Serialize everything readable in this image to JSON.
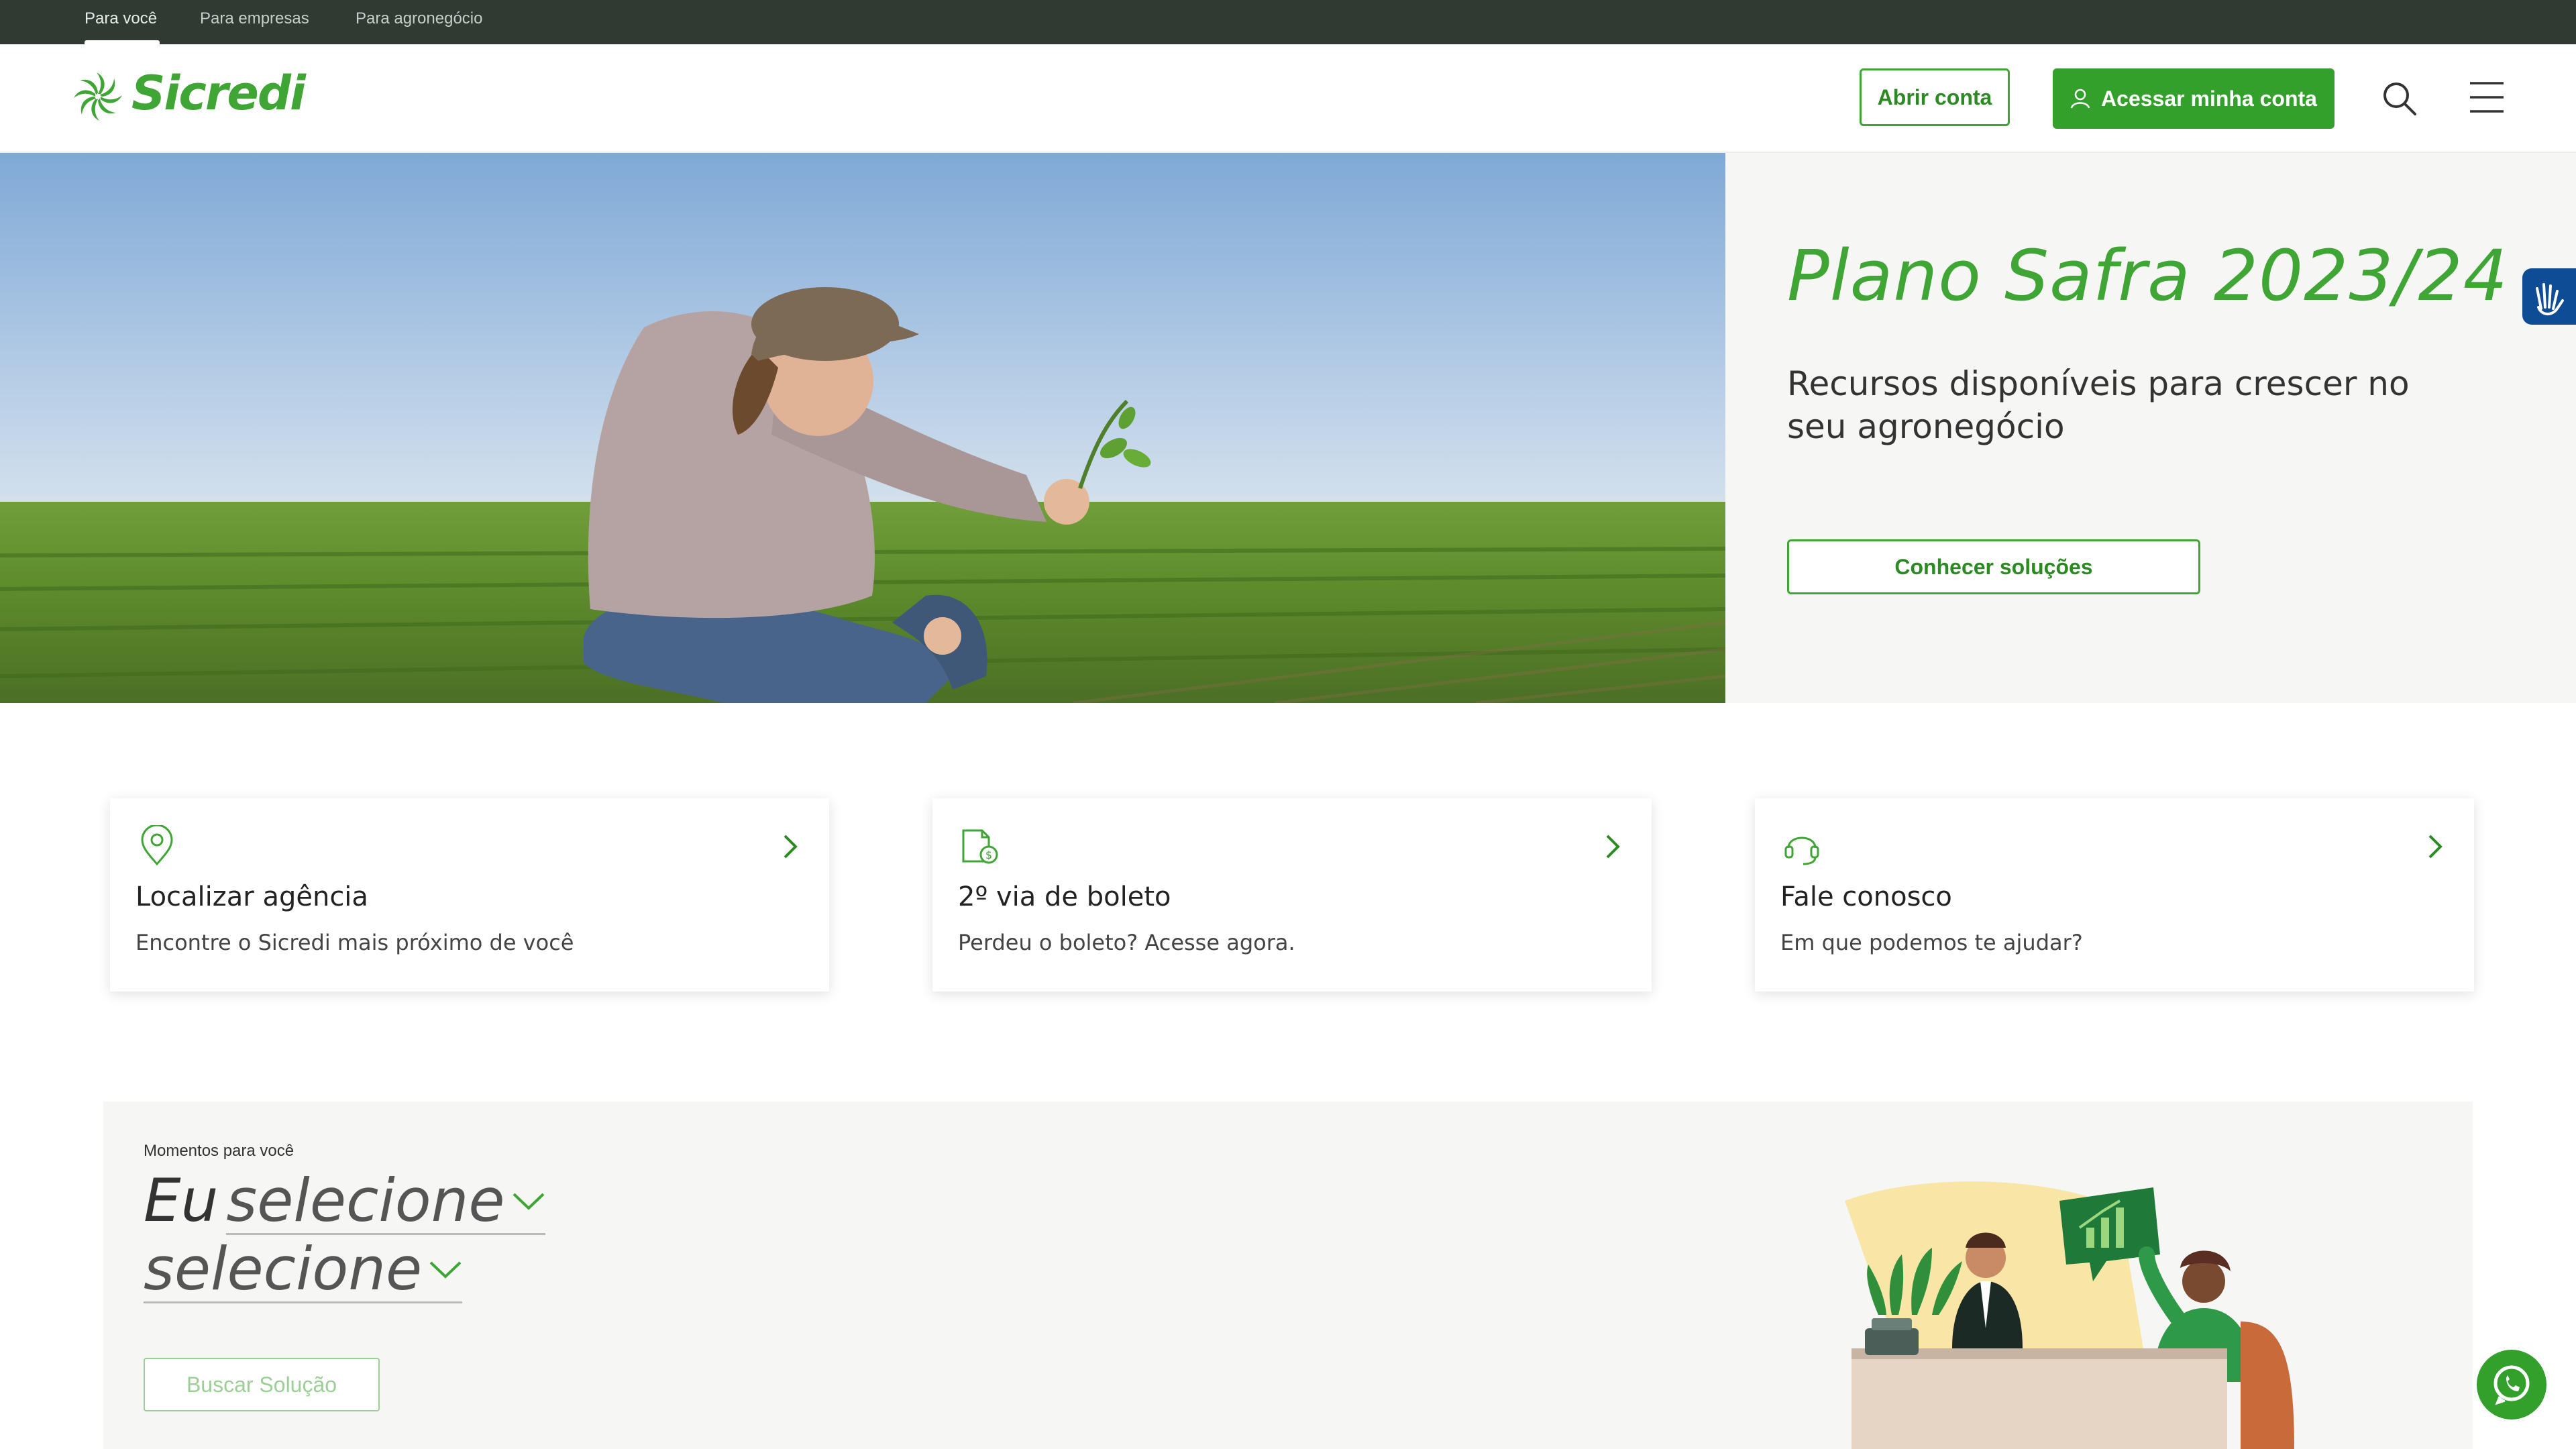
{
  "topbar": {
    "links": [
      "Para você",
      "Para empresas",
      "Para agronegócio"
    ]
  },
  "header": {
    "logo_text": "Sicredi",
    "open_account": "Abrir conta",
    "access_account": "Acessar minha conta"
  },
  "hero": {
    "title": "Plano Safra 2023/24",
    "subtitle": "Recursos disponíveis para crescer no seu agronegócio",
    "cta": "Conhecer soluções"
  },
  "cards": [
    {
      "title": "Localizar agência",
      "desc": "Encontre o Sicredi mais próximo de você",
      "icon": "location-pin-icon"
    },
    {
      "title": "2º via de boleto",
      "desc": "Perdeu o boleto? Acesse agora.",
      "icon": "boleto-document-icon"
    },
    {
      "title": "Fale conosco",
      "desc": "Em que podemos te ajudar?",
      "icon": "headset-icon"
    }
  ],
  "moments": {
    "label": "Momentos para você",
    "prefix": "Eu",
    "select1": "selecione",
    "select2": "selecione",
    "button": "Buscar Solução"
  },
  "colors": {
    "brand_green": "#3fa535",
    "topbar": "#2f3a33",
    "accessibility_blue": "#0f4c96"
  }
}
